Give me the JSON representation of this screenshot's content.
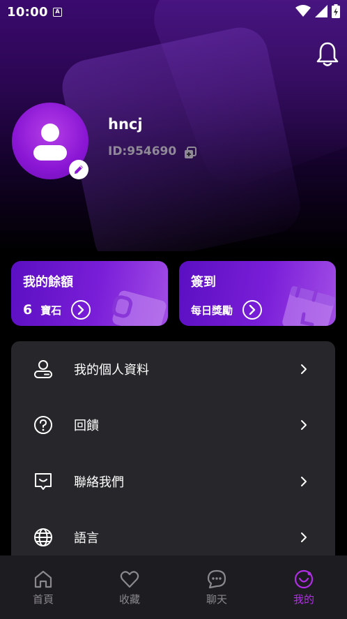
{
  "status_bar": {
    "time": "10:00",
    "badge": "A"
  },
  "profile": {
    "username": "hncj",
    "user_id": "ID:954690"
  },
  "cards": {
    "balance": {
      "title": "我的餘額",
      "amount": "6",
      "unit": "寶石"
    },
    "checkin": {
      "title": "簽到",
      "subtitle": "每日獎勵"
    }
  },
  "menu": {
    "items": [
      {
        "label": "我的個人資料",
        "icon": "user-icon"
      },
      {
        "label": "回饋",
        "icon": "question-icon"
      },
      {
        "label": "聯絡我們",
        "icon": "message-icon"
      },
      {
        "label": "語言",
        "icon": "globe-icon"
      }
    ]
  },
  "tabs": [
    {
      "label": "首頁",
      "icon": "home-icon",
      "active": false
    },
    {
      "label": "收藏",
      "icon": "heart-icon",
      "active": false
    },
    {
      "label": "聊天",
      "icon": "chat-icon",
      "active": false
    },
    {
      "label": "我的",
      "icon": "profile-smile-icon",
      "active": true
    }
  ],
  "colors": {
    "accent": "#b02fe6",
    "card_start": "#5a0fc2",
    "card_end": "#a24de6",
    "menu_bg": "#27262a",
    "tabbar_bg": "#1d1c20"
  }
}
